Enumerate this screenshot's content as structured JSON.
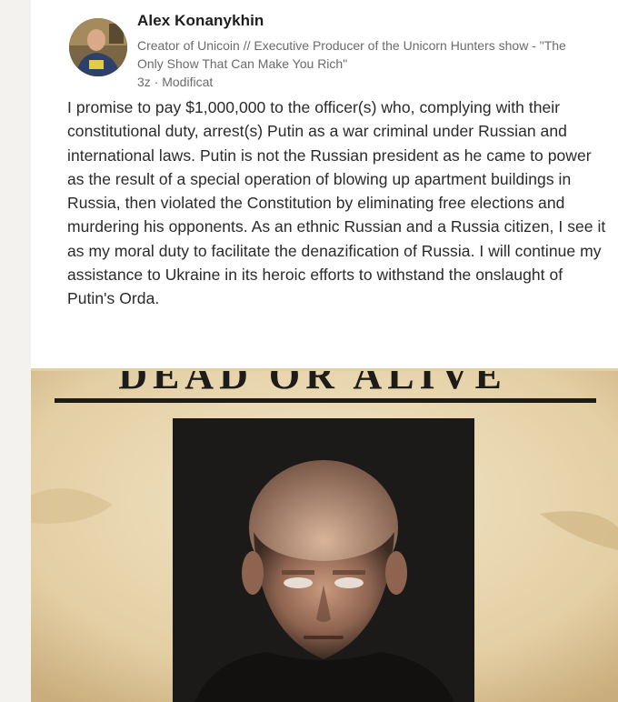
{
  "post": {
    "author": {
      "name": "Alex Konanykhin",
      "headline": "Creator of Unicoin // Executive Producer of the Unicorn Hunters show - \"The Only Show That Can Make You Rich\"",
      "meta": "3z · Modificat"
    },
    "text": "I promise to pay $1,000,000 to the officer(s) who, complying with their constitutional duty, arrest(s) Putin as a war criminal under Russian and international laws. Putin is not the Russian president as he came to power as the result of a special operation of blowing up apartment buildings in Russia, then violated the Constitution by eliminating free elections and murdering his opponents. As an ethnic Russian and a Russia citizen, I see it as my moral duty to facilitate the denazification of Russia. I will continue my assistance to Ukraine in its heroic efforts to withstand the onslaught of Putin's Orda.",
    "image": {
      "poster_heading": "DEAD OR ALIVE"
    }
  },
  "colors": {
    "name": "#1d1d1d",
    "secondary_text": "#6b6b6b",
    "body_text": "#2a2a2a",
    "poster_paper": "#e9d9b8",
    "poster_ink": "#1e1c18"
  }
}
